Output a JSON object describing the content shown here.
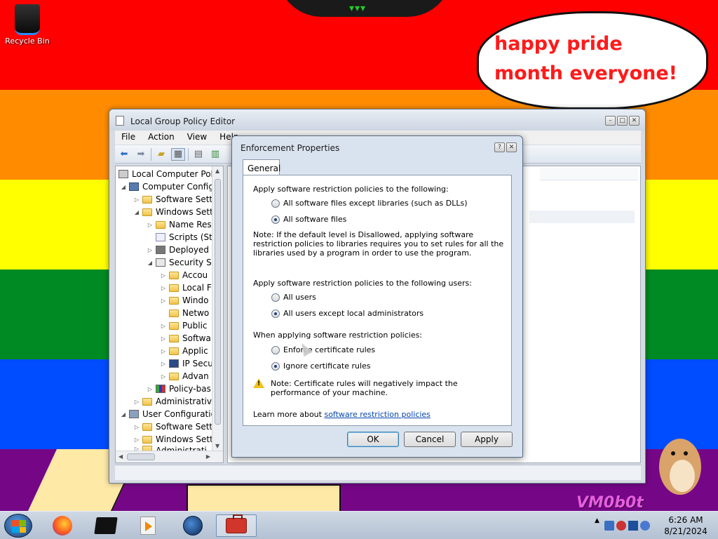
{
  "desktop": {
    "recycle_bin_label": "Recycle Bin",
    "speech_bubble_text": "happy pride month everyone!",
    "watermark_text": "VM0b0t",
    "colors": {
      "red": "#ff0000",
      "orange": "#ff8c00",
      "yellow": "#ffff00",
      "green": "#008a23",
      "blue": "#004cff",
      "purple": "#750787"
    }
  },
  "main_window": {
    "title": "Local Group Policy Editor",
    "menu": [
      "File",
      "Action",
      "View",
      "Help"
    ],
    "toolbar_icons": [
      "back-arrow-icon",
      "forward-arrow-icon",
      "up-folder-icon",
      "show-hide-tree-icon",
      "properties-icon",
      "export-list-icon"
    ],
    "tree": [
      {
        "label": "Local Computer Polic",
        "icon": "policy-icon",
        "twisty": ""
      },
      {
        "label": "Computer Config",
        "icon": "computer-icon",
        "twisty": "◢"
      },
      {
        "label": "Software Setti",
        "icon": "folder-icon",
        "twisty": "▷"
      },
      {
        "label": "Windows Sett",
        "icon": "folder-icon",
        "twisty": "◢"
      },
      {
        "label": "Name Res",
        "icon": "folder-icon",
        "twisty": "▷"
      },
      {
        "label": "Scripts (Sta",
        "icon": "scripts-icon",
        "twisty": ""
      },
      {
        "label": "Deployed",
        "icon": "printer-icon",
        "twisty": "▷"
      },
      {
        "label": "Security Se",
        "icon": "security-icon",
        "twisty": "◢"
      },
      {
        "label": "Accou",
        "icon": "folder-lock-icon",
        "twisty": "▷"
      },
      {
        "label": "Local F",
        "icon": "folder-lock-icon",
        "twisty": "▷"
      },
      {
        "label": "Windo",
        "icon": "folder-icon",
        "twisty": "▷"
      },
      {
        "label": "Netwo",
        "icon": "folder-icon",
        "twisty": ""
      },
      {
        "label": "Public",
        "icon": "folder-icon",
        "twisty": "▷"
      },
      {
        "label": "Softwa",
        "icon": "folder-icon",
        "twisty": "▷"
      },
      {
        "label": "Applic",
        "icon": "folder-icon",
        "twisty": "▷"
      },
      {
        "label": "IP Secu",
        "icon": "ipsec-icon",
        "twisty": "▷"
      },
      {
        "label": "Advan",
        "icon": "folder-icon",
        "twisty": "▷"
      },
      {
        "label": "Policy-bas",
        "icon": "chart-icon",
        "twisty": "▷"
      },
      {
        "label": "Administrativ",
        "icon": "folder-icon",
        "twisty": "▷"
      },
      {
        "label": "User Configuratio",
        "icon": "user-icon",
        "twisty": "◢"
      },
      {
        "label": "Software Setti",
        "icon": "folder-icon",
        "twisty": "▷"
      },
      {
        "label": "Windows Sett",
        "icon": "folder-icon",
        "twisty": "▷"
      },
      {
        "label": "Administrati",
        "icon": "folder-icon",
        "twisty": "▷"
      }
    ]
  },
  "dialog": {
    "title": "Enforcement Properties",
    "tab": "General",
    "apply_to_label": "Apply software restriction policies to the following:",
    "apply_to_options": [
      {
        "label": "All software files except libraries (such as DLLs)",
        "selected": false
      },
      {
        "label": "All software files",
        "selected": true
      }
    ],
    "dll_note": "Note:  If the default level is Disallowed, applying software restriction policies to libraries requires you to set rules for all the libraries used by a program in order to use the program.",
    "users_label": "Apply software restriction policies to the following users:",
    "users_options": [
      {
        "label": "All users",
        "selected": false
      },
      {
        "label": "All users except local administrators",
        "selected": true
      }
    ],
    "cert_label": "When applying software restriction policies:",
    "cert_options": [
      {
        "label": "Enforce certificate rules",
        "selected": false
      },
      {
        "label": "Ignore certificate rules",
        "selected": true
      }
    ],
    "cert_note": "Note:  Certificate rules will negatively impact the performance of your machine.",
    "learn_more_prefix": "Learn more about ",
    "learn_more_link": "software restriction policies",
    "buttons": {
      "ok": "OK",
      "cancel": "Cancel",
      "apply": "Apply"
    }
  },
  "taskbar": {
    "pinned": [
      "firefox-icon",
      "monitor-icon",
      "media-player-icon",
      "globe-icon",
      "toolbox-icon"
    ],
    "active_index": 4,
    "clock_time": "6:26 AM",
    "clock_date": "8/21/2024"
  }
}
